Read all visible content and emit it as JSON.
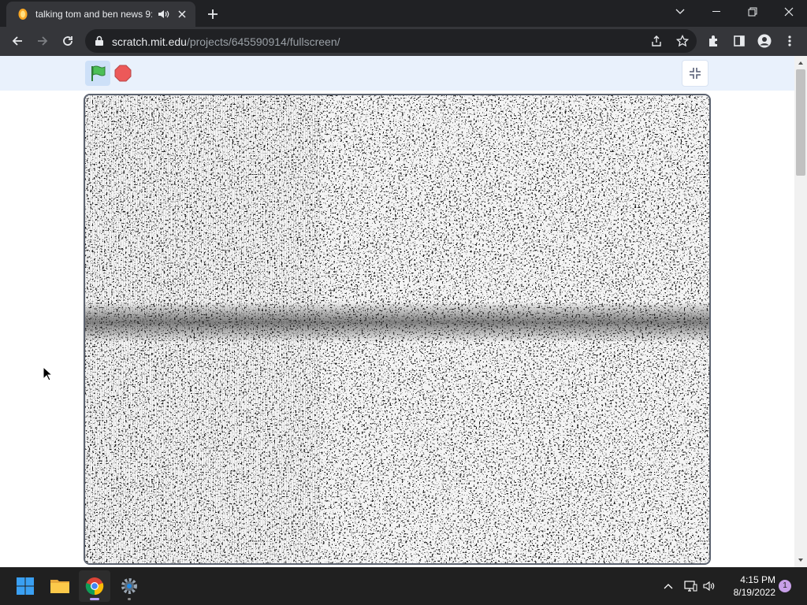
{
  "browser": {
    "tab": {
      "title": "talking tom and ben news 9:"
    },
    "address_bar": {
      "host": "scratch.mit.edu",
      "path": "/projects/645590914/fullscreen/"
    }
  },
  "scratch_player": {
    "controls": {
      "green_flag_icon": "green-flag-icon",
      "stop_icon": "stop-icon",
      "unfullscreen_icon": "unfullscreen-icon"
    },
    "stage_content": "tv-static-noise",
    "colors": {
      "controls_bar": "#e9f1fc",
      "flag": "#4cbf56",
      "stop": "#ec5959",
      "stage_border": "#5c6370"
    }
  },
  "taskbar": {
    "apps": [
      "start-icon",
      "file-explorer-icon",
      "chrome-icon",
      "settings-icon"
    ],
    "clock": {
      "time": "4:15 PM",
      "date": "8/19/2022"
    },
    "notification_count": "1"
  }
}
